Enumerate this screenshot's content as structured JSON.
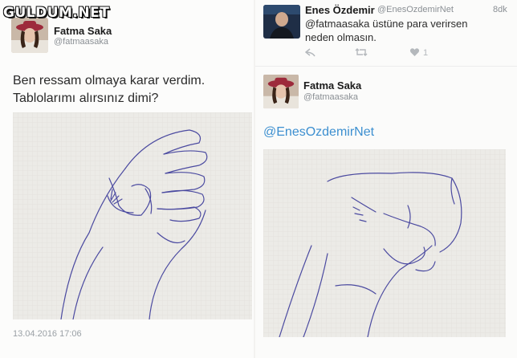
{
  "watermark": "GULDUM.NET",
  "left_tweet": {
    "name": "Fatma Saka",
    "handle": "@fatmaasaka",
    "text_line1": "Ben ressam olmaya karar verdim.",
    "text_line2": "Tablolarımı alırsınız dimi?",
    "date": "13.04.2016 17:06"
  },
  "reply_tweet": {
    "name": "Enes Özdemir",
    "handle": "@EnesOzdemirNet",
    "time": "8dk",
    "text_line1": "@fatmaasaka üstüne para verirsen",
    "text_line2": "neden olmasın.",
    "like_count": "1"
  },
  "right_tweet": {
    "name": "Fatma Saka",
    "handle": "@fatmaasaka",
    "mention": "@EnesOzdemirNet"
  },
  "colors": {
    "link": "#3c8fd0",
    "paper": "#ecebe7",
    "ink": "#4a4aa0"
  }
}
